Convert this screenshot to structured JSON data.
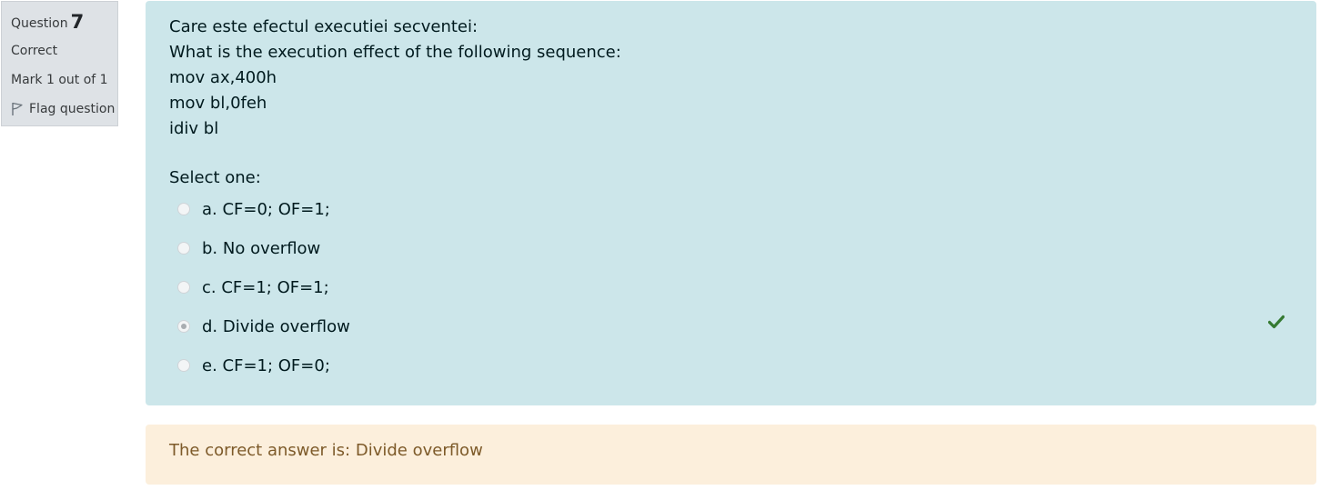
{
  "info": {
    "question_label": "Question",
    "question_number": "7",
    "state": "Correct",
    "grade": "Mark 1 out of 1",
    "flag_label": "Flag question"
  },
  "question": {
    "lines": [
      "Care este efectul executiei secventei:",
      "What is the execution effect of the following sequence:",
      "mov ax,400h",
      "mov bl,0feh",
      "idiv bl"
    ],
    "prompt": "Select one:",
    "options": [
      {
        "label": "a. CF=0; OF=1;",
        "selected": false
      },
      {
        "label": "b. No overflow",
        "selected": false
      },
      {
        "label": "c. CF=1; OF=1;",
        "selected": false
      },
      {
        "label": "d. Divide overflow",
        "selected": true,
        "correct": true
      },
      {
        "label": "e. CF=1; OF=0;",
        "selected": false
      }
    ]
  },
  "feedback": {
    "right_answer": "The correct answer is: Divide overflow"
  },
  "colors": {
    "info_bg": "#dee2e6",
    "formulation_bg": "#cce6ea",
    "feedback_bg": "#fcefdc",
    "feedback_text": "#7d5a29",
    "correct_icon": "#357a32"
  },
  "icons": {
    "flag": "flag-outline-icon",
    "correct": "checkmark-icon"
  }
}
